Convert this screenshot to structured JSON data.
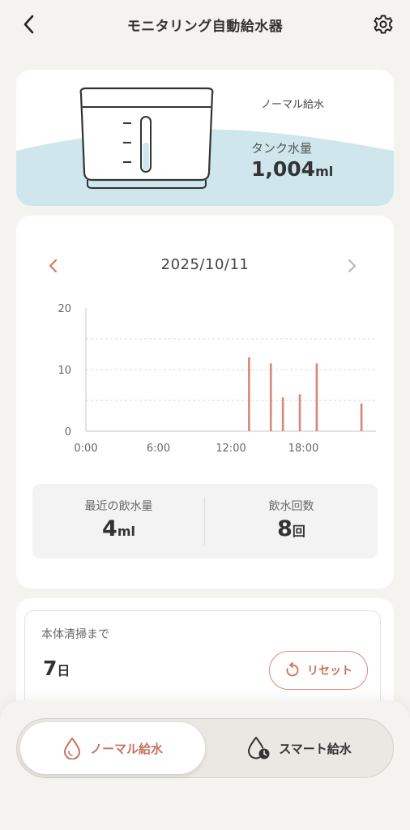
{
  "header": {
    "title": "モニタリング自動給水器"
  },
  "tank": {
    "mode_label": "ノーマル給水",
    "tank_label": "タンク水量",
    "amount_value": "1,004",
    "amount_unit": "ml"
  },
  "date_nav": {
    "date": "2025/10/11"
  },
  "chart_data": {
    "type": "bar",
    "x_tick_labels": [
      "0:00",
      "6:00",
      "12:00",
      "18:00"
    ],
    "x_tick_hours": [
      0,
      6,
      12,
      18
    ],
    "y_tick_labels": [
      "20",
      "10",
      "0"
    ],
    "y_ticks": [
      20,
      10,
      0
    ],
    "xlim": [
      0,
      24
    ],
    "ylim": [
      0,
      20
    ],
    "grid": "horizontal-dashed",
    "bar_color": "#d6877a",
    "points": [
      {
        "x": 13.5,
        "y": 12
      },
      {
        "x": 15.3,
        "y": 11
      },
      {
        "x": 16.3,
        "y": 5.5
      },
      {
        "x": 17.7,
        "y": 6
      },
      {
        "x": 19.1,
        "y": 11
      },
      {
        "x": 22.8,
        "y": 4.5
      }
    ]
  },
  "stats": {
    "recent_label": "最近の飲水量",
    "recent_value": "4",
    "recent_unit": "ml",
    "count_label": "飲水回数",
    "count_value": "8",
    "count_unit": "回"
  },
  "cleaning": {
    "label": "本体清掃まで",
    "value": "7",
    "unit": "日",
    "reset_label": "リセット"
  },
  "mode_toggle": {
    "normal_label": "ノーマル給水",
    "smart_label": "スマート給水",
    "selected": "normal"
  },
  "colors": {
    "accent": "#c8725f",
    "water": "#cfe7ec",
    "background": "#f5f3ef"
  }
}
